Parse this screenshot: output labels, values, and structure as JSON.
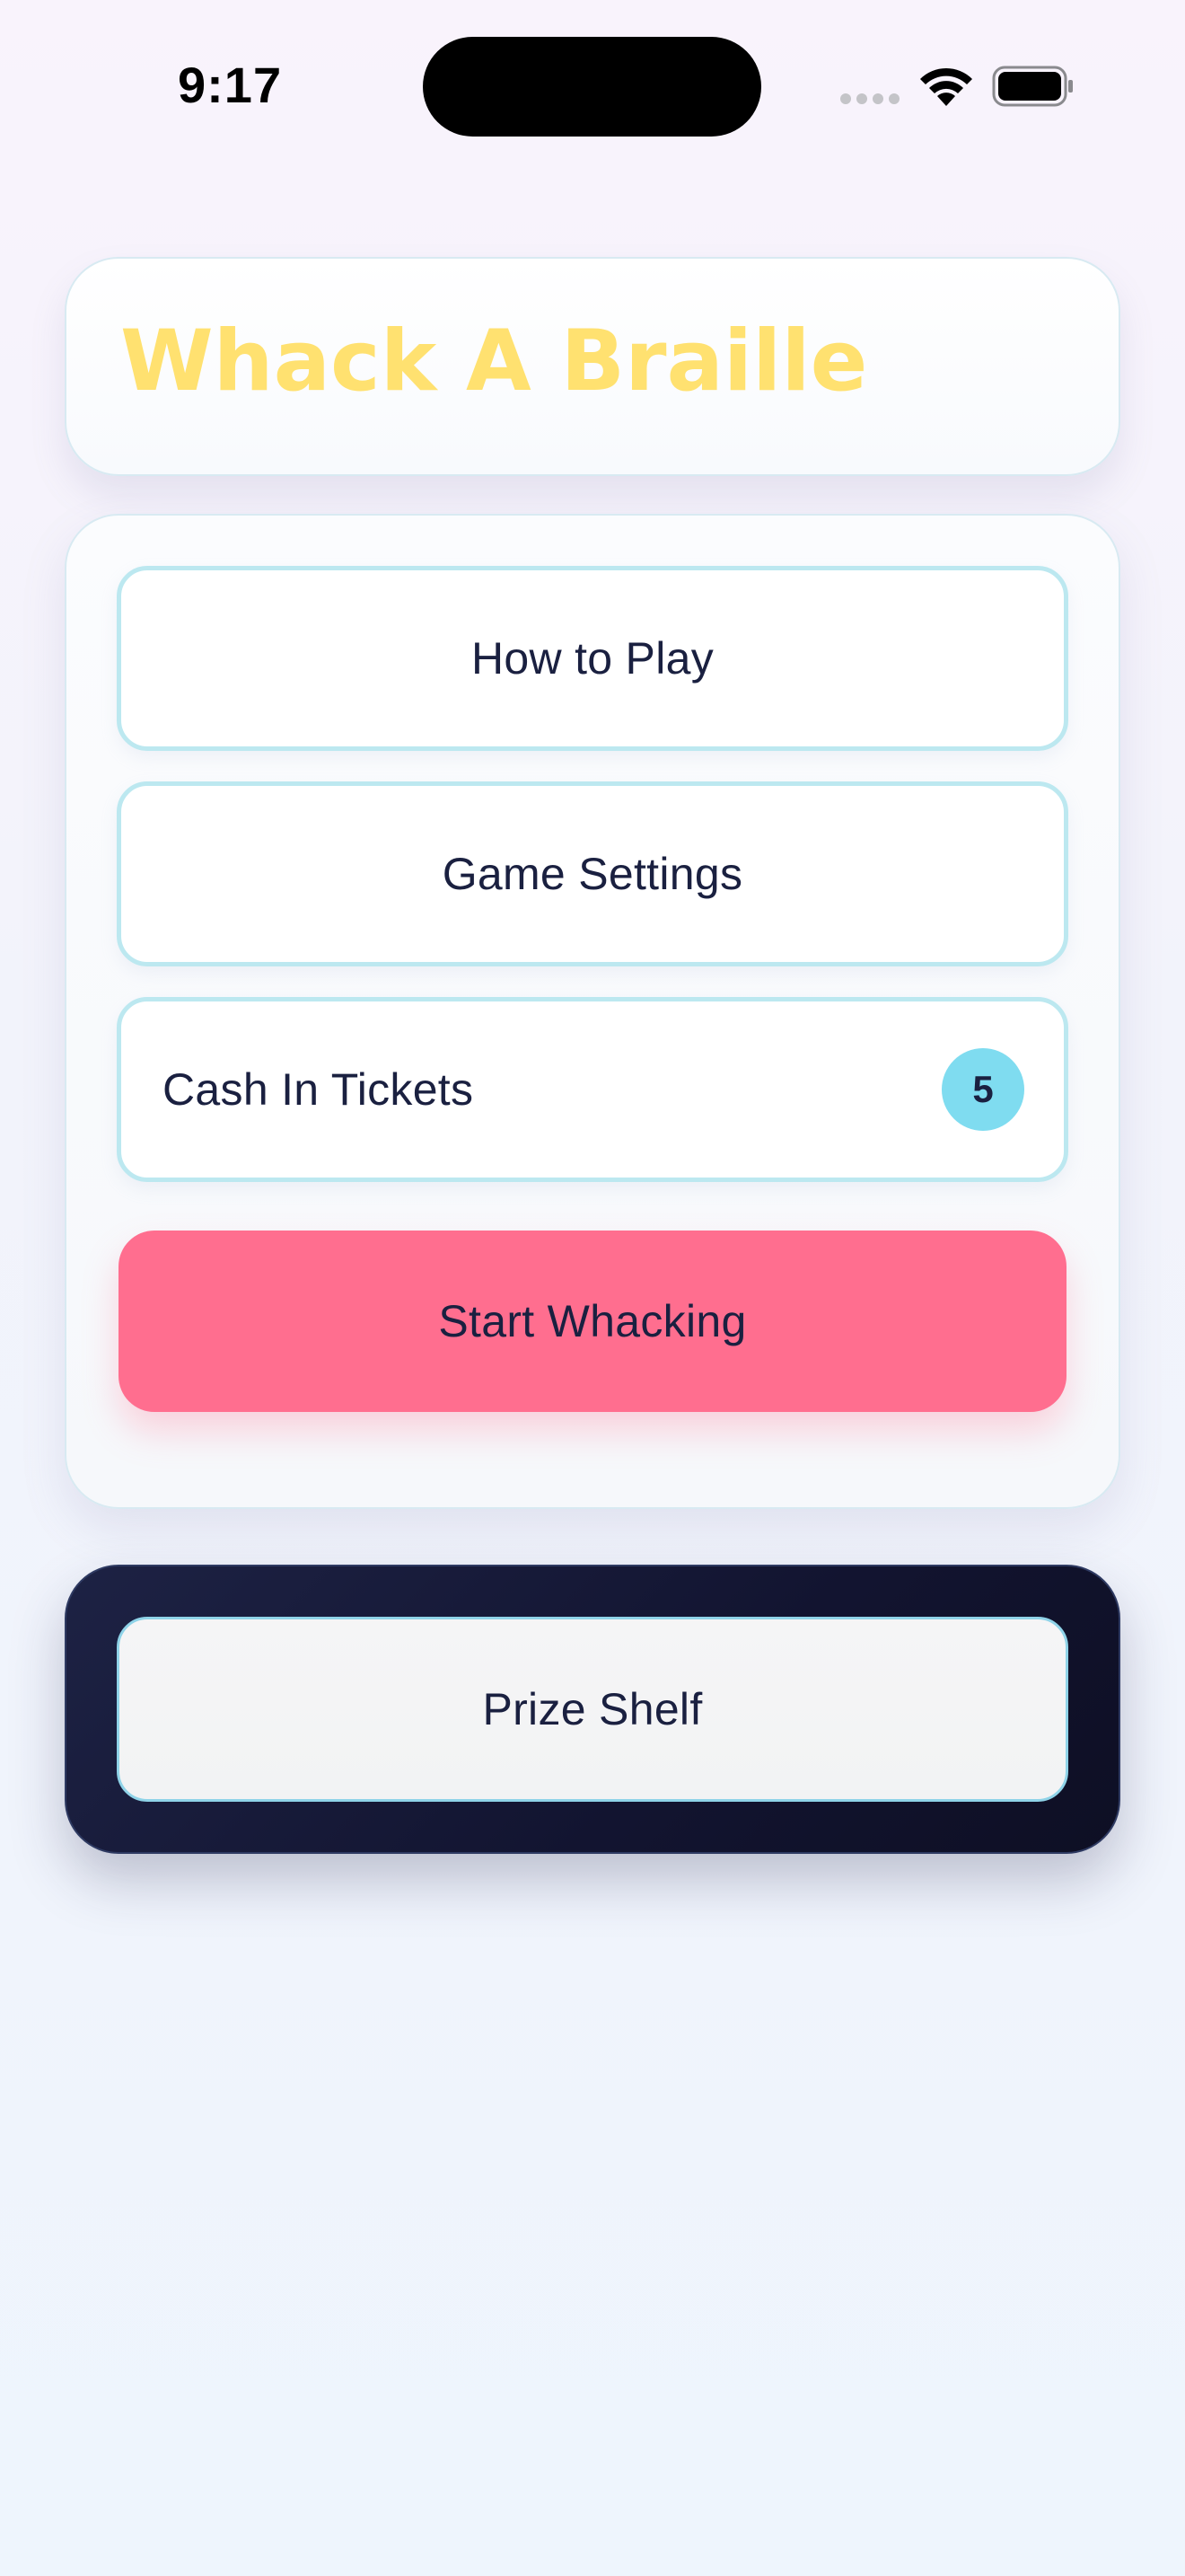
{
  "status_bar": {
    "time": "9:17"
  },
  "header": {
    "title": "Whack A Braille",
    "title_color": "#ffe170"
  },
  "menu": {
    "how_to_play_label": "How to Play",
    "game_settings_label": "Game Settings",
    "cash_in_label": "Cash In Tickets",
    "ticket_count": "5",
    "start_label": "Start Whacking"
  },
  "prize": {
    "prize_shelf_label": "Prize Shelf"
  },
  "colors": {
    "accent_pink": "#ff6e8f",
    "accent_cyan": "#7fdcf0",
    "dark_card": "#121430",
    "text_dark": "#1a2040"
  },
  "icons": {
    "signal": "cellular-signal-icon",
    "wifi": "wifi-icon",
    "battery": "battery-icon"
  }
}
